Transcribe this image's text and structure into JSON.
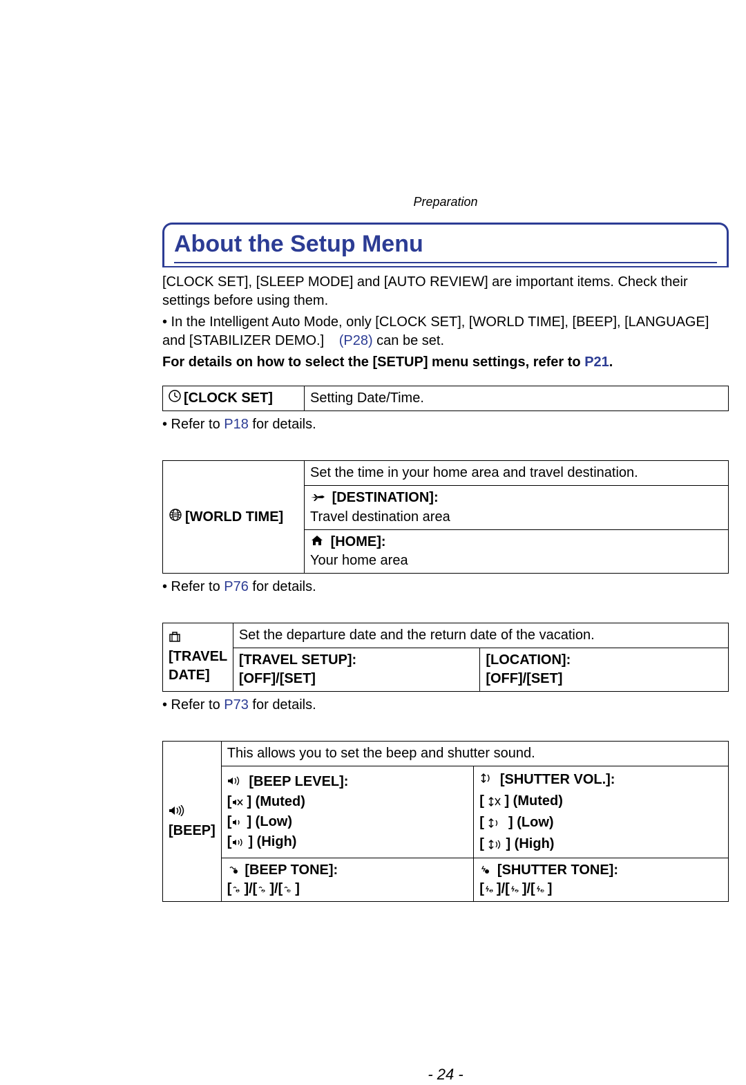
{
  "section": "Preparation",
  "title": "About the Setup Menu",
  "intro": {
    "p1": "[CLOCK SET], [SLEEP MODE] and [AUTO REVIEW] are important items. Check their settings before using them.",
    "p2a": "• In the Intelligent Auto Mode, only [CLOCK SET], [WORLD TIME], [BEEP], [LANGUAGE] and [STABILIZER DEMO.] ",
    "p2link": "(P28)",
    "p2b": " can be set.",
    "p3a": "For details on how to select the [SETUP] menu settings, refer to ",
    "p3link": "P21",
    "p3b": "."
  },
  "clockset": {
    "label": "[CLOCK SET]",
    "desc": "Setting Date/Time."
  },
  "clockset_note_a": "• Refer to ",
  "clockset_note_link": "P18",
  "clockset_note_b": " for details.",
  "worldtime": {
    "label": "[WORLD TIME]",
    "desc": "Set the time in your home area and travel destination.",
    "dest_title": "[DESTINATION]:",
    "dest_sub": "Travel destination area",
    "home_title": "[HOME]:",
    "home_sub": "Your home area"
  },
  "worldtime_note_a": "• Refer to ",
  "worldtime_note_link": "P76",
  "worldtime_note_b": " for details.",
  "traveldate": {
    "label": "[TRAVEL DATE]",
    "desc": "Set the departure date and the return date of the vacation.",
    "setup_title": "[TRAVEL SETUP]:",
    "setup_opts": "[OFF]/[SET]",
    "loc_title": "[LOCATION]:",
    "loc_opts": "[OFF]/[SET]"
  },
  "traveldate_note_a": "• Refer to ",
  "traveldate_note_link": "P73",
  "traveldate_note_b": " for details.",
  "beep": {
    "label": "[BEEP]",
    "desc": "This allows you to set the beep and shutter sound.",
    "beeplevel_title": "[BEEP LEVEL]:",
    "beeplevel_muted": "] (Muted)",
    "beeplevel_low": "] (Low)",
    "beeplevel_high": "] (High)",
    "beeptone_title": "[BEEP TONE]:",
    "beeptone_opts": "]/[",
    "shuttervol_title": "[SHUTTER VOL.]:",
    "shuttervol_muted": "] (Muted)",
    "shuttervol_low": "] (Low)",
    "shuttervol_high": "] (High)",
    "shuttertone_title": "[SHUTTER TONE]:",
    "shuttertone_opts": "]/["
  },
  "page_number": "- 24 -"
}
